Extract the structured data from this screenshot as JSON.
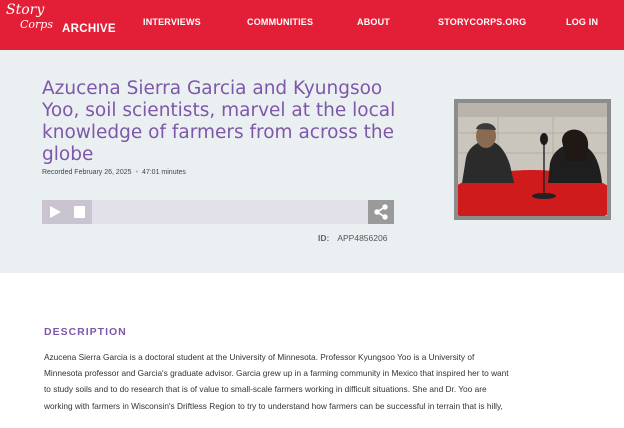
{
  "nav": {
    "logo_script_1": "Story",
    "logo_script_2": "Corps",
    "logo_archive": "ARCHIVE",
    "links": [
      "INTERVIEWS",
      "COMMUNITIES",
      "ABOUT",
      "STORYCORPS.ORG",
      "LOG IN"
    ]
  },
  "hero": {
    "title": "Azucena Sierra Garcia and Kyungsoo Yoo, soil scientists, marvel at the local knowledge of farmers from across the globe",
    "recorded": "Recorded February 26, 2025",
    "separator": "•",
    "duration": "47:01 minutes",
    "id_label": "ID:",
    "id_value": "APP4856206"
  },
  "player": {
    "play_icon": "play-icon",
    "stop_icon": "stop-icon",
    "share_icon": "share-icon",
    "progress": 0
  },
  "description": {
    "heading": "DESCRIPTION",
    "text": "Azucena Sierra Garcia is a doctoral student at the University of Minnesota. Professor Kyungsoo Yoo is a University of Minnesota professor and Garcia's graduate advisor. Garcia grew up in a farming community in Mexico that inspired her to want to study soils and to do research that is of value to small-scale farmers working in difficult situations. She and Dr. Yoo are working with farmers in Wisconsin's Driftless Region to try to understand how farmers can be successful in terrain that is hilly,"
  },
  "colors": {
    "brand_red": "#e21f36",
    "title_purple": "#7e57a8",
    "hero_bg": "#eaf0f2"
  }
}
